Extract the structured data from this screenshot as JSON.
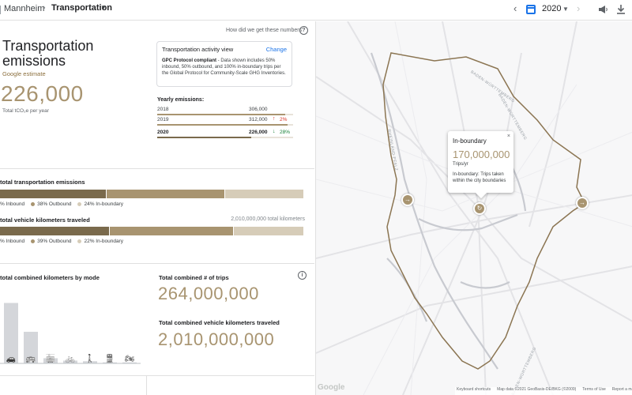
{
  "header": {
    "city": "Mannheim",
    "separator": "›",
    "page": "Transportation",
    "year": "2020"
  },
  "summary": {
    "help_link": "How did we get these numbers?",
    "title": "Transportation emissions",
    "estimate_label": "Google estimate",
    "total": "226,000",
    "total_unit": "Total tCO₂e per year"
  },
  "activity_view": {
    "title": "Transportation activity view",
    "change_label": "Change",
    "body_bold": "GPC Protocol compliant",
    "body": " - Data shown includes 50% inbound, 50% outbound, and 100% in-boundary trips per the Global Protocol for Community-Scale GHG Inventories."
  },
  "yearly": {
    "label": "Yearly emissions:",
    "rows": [
      {
        "year": "2018",
        "value": "306,000",
        "arrow": "",
        "pct": "",
        "fill": 0.94
      },
      {
        "year": "2019",
        "value": "312,000",
        "arrow": "↑",
        "pct": "2%",
        "fill": 0.96
      },
      {
        "year": "2020",
        "value": "226,000",
        "arrow": "↓",
        "pct": "28%",
        "fill": 0.69
      }
    ]
  },
  "emissions_split": {
    "label": "total transportation emissions",
    "segments": [
      {
        "label": "% Inbound",
        "share": 0.35,
        "color": "#7a6a4c"
      },
      {
        "label": "38% Outbound",
        "share": 0.39,
        "color": "#a89470"
      },
      {
        "label": "24% In-boundary",
        "share": 0.26,
        "color": "#d6ccb8"
      }
    ]
  },
  "vkt_split": {
    "label": "total vehicle kilometers traveled",
    "right_label": "2,010,000,000 total kilometers",
    "segments": [
      {
        "label": "% Inbound",
        "share": 0.36,
        "color": "#7a6a4c"
      },
      {
        "label": "39% Outbound",
        "share": 0.41,
        "color": "#a89470"
      },
      {
        "label": "22% In-boundary",
        "share": 0.23,
        "color": "#d6ccb8"
      }
    ]
  },
  "modes": {
    "label": "total combined kilometers by mode",
    "icons": [
      "car-icon",
      "bus-icon",
      "tram-icon",
      "bicycle-icon",
      "walk-icon",
      "train-icon",
      "motorcycle-icon"
    ],
    "glyphs": [
      "🚗",
      "🚌",
      "🚋",
      "🚲",
      "🚶",
      "🚆",
      "🏍"
    ]
  },
  "chart_data": {
    "type": "bar",
    "categories": [
      "car",
      "bus",
      "tram",
      "bicycle",
      "walk",
      "train",
      "motorcycle"
    ],
    "values": [
      100,
      52,
      8,
      4,
      3,
      1,
      1
    ],
    "ylim": [
      0,
      100
    ]
  },
  "trips": {
    "label": "Total combined # of trips",
    "value": "264,000,000"
  },
  "vkt_total": {
    "label": "Total combined vehicle kilometers traveled",
    "value": "2,010,000,000"
  },
  "map": {
    "labels": [
      "BADEN-WÜRTTEMBERG",
      "BADEN-WÜRTTEMBERG",
      "RHEINLAND-PFALZ",
      "BADEN-WÜRTTEMBERG"
    ],
    "popup": {
      "title": "In-boundary",
      "value": "170,000,000",
      "unit": "Trips/yr",
      "description": "In-boundary: Trips taken within the city boundaries",
      "close": "×"
    },
    "google": "Google",
    "footer": [
      "Keyboard shortcuts",
      "Map data ©2021 GeoBasis-DE/BKG (©2009)",
      "Terms of Use",
      "Report a map error"
    ]
  }
}
